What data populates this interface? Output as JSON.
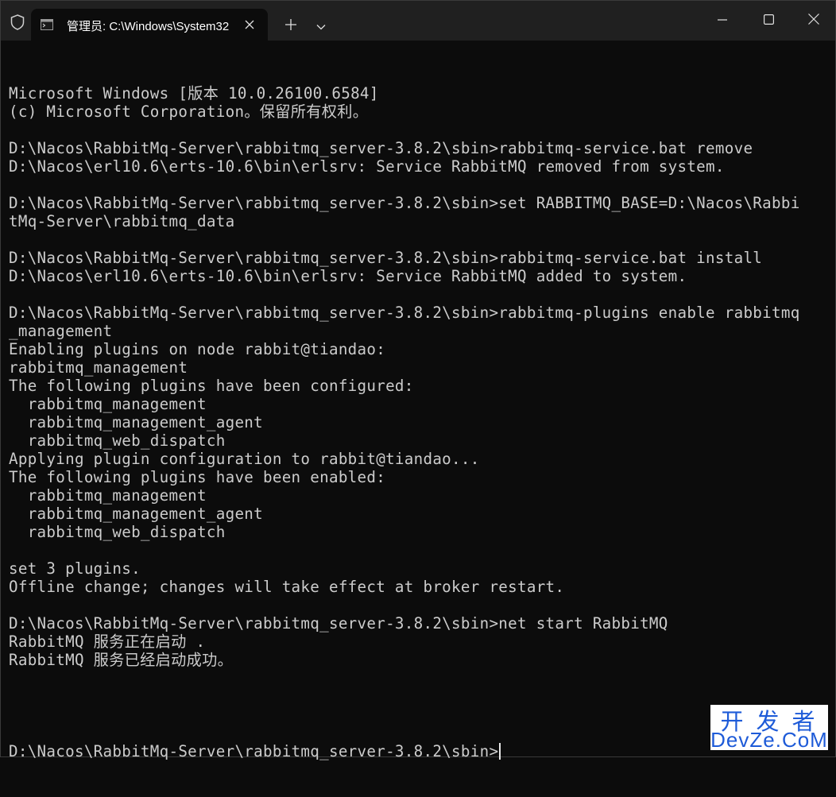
{
  "tab": {
    "title": "管理员: C:\\Windows\\System32"
  },
  "terminal": {
    "lines": [
      "Microsoft Windows [版本 10.0.26100.6584]",
      "(c) Microsoft Corporation。保留所有权利。",
      "",
      "D:\\Nacos\\RabbitMq-Server\\rabbitmq_server-3.8.2\\sbin>rabbitmq-service.bat remove",
      "D:\\Nacos\\erl10.6\\erts-10.6\\bin\\erlsrv: Service RabbitMQ removed from system.",
      "",
      "D:\\Nacos\\RabbitMq-Server\\rabbitmq_server-3.8.2\\sbin>set RABBITMQ_BASE=D:\\Nacos\\Rabbi",
      "tMq-Server\\rabbitmq_data",
      "",
      "D:\\Nacos\\RabbitMq-Server\\rabbitmq_server-3.8.2\\sbin>rabbitmq-service.bat install",
      "D:\\Nacos\\erl10.6\\erts-10.6\\bin\\erlsrv: Service RabbitMQ added to system.",
      "",
      "D:\\Nacos\\RabbitMq-Server\\rabbitmq_server-3.8.2\\sbin>rabbitmq-plugins enable rabbitmq",
      "_management",
      "Enabling plugins on node rabbit@tiandao:",
      "rabbitmq_management",
      "The following plugins have been configured:",
      "  rabbitmq_management",
      "  rabbitmq_management_agent",
      "  rabbitmq_web_dispatch",
      "Applying plugin configuration to rabbit@tiandao...",
      "The following plugins have been enabled:",
      "  rabbitmq_management",
      "  rabbitmq_management_agent",
      "  rabbitmq_web_dispatch",
      "",
      "set 3 plugins.",
      "Offline change; changes will take effect at broker restart.",
      "",
      "D:\\Nacos\\RabbitMq-Server\\rabbitmq_server-3.8.2\\sbin>net start RabbitMQ",
      "RabbitMQ 服务正在启动 .",
      "RabbitMQ 服务已经启动成功。",
      "",
      ""
    ],
    "prompt": "D:\\Nacos\\RabbitMq-Server\\rabbitmq_server-3.8.2\\sbin>"
  },
  "watermark": {
    "cn": "开发者",
    "en": "DevZe.CoM"
  },
  "icons": {
    "shield": "shield-icon",
    "tab": "terminal-icon",
    "close_tab": "close-icon",
    "new_tab": "plus-icon",
    "dropdown": "chevron-down-icon",
    "minimize": "minimize-icon",
    "maximize": "maximize-icon",
    "close_window": "close-icon"
  },
  "colors": {
    "background": "#0c0c0c",
    "titlebar": "#202020",
    "text": "#cccccc",
    "watermark": "#1e5bd8"
  }
}
